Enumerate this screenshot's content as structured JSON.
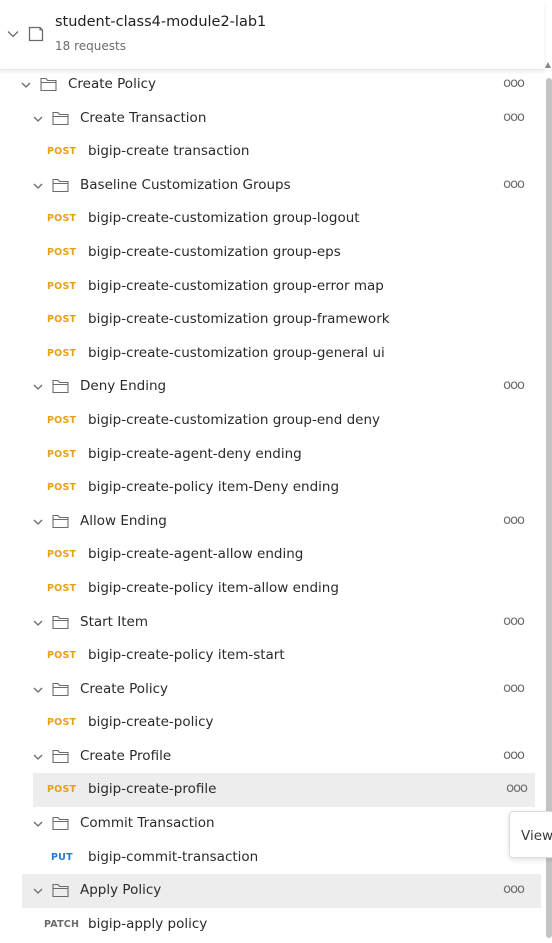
{
  "collection": {
    "name": "student-class4-module2-lab1",
    "request_count": "18 requests"
  },
  "tree": [
    {
      "kind": "folder",
      "depth": 0,
      "label": "Create Policy",
      "more": "ooo"
    },
    {
      "kind": "folder",
      "depth": 1,
      "label": "Create Transaction",
      "more": "ooo"
    },
    {
      "kind": "request",
      "method": "POST",
      "label": "bigip-create transaction"
    },
    {
      "kind": "folder",
      "depth": 1,
      "label": "Baseline Customization Groups",
      "more": "ooo"
    },
    {
      "kind": "request",
      "method": "POST",
      "label": "bigip-create-customization group-logout"
    },
    {
      "kind": "request",
      "method": "POST",
      "label": "bigip-create-customization group-eps"
    },
    {
      "kind": "request",
      "method": "POST",
      "label": "bigip-create-customization group-error map"
    },
    {
      "kind": "request",
      "method": "POST",
      "label": "bigip-create-customization group-framework"
    },
    {
      "kind": "request",
      "method": "POST",
      "label": "bigip-create-customization group-general ui"
    },
    {
      "kind": "folder",
      "depth": 1,
      "label": "Deny Ending",
      "more": "ooo"
    },
    {
      "kind": "request",
      "method": "POST",
      "label": "bigip-create-customization group-end deny"
    },
    {
      "kind": "request",
      "method": "POST",
      "label": "bigip-create-agent-deny ending"
    },
    {
      "kind": "request",
      "method": "POST",
      "label": "bigip-create-policy item-Deny ending"
    },
    {
      "kind": "folder",
      "depth": 1,
      "label": "Allow Ending",
      "more": "ooo"
    },
    {
      "kind": "request",
      "method": "POST",
      "label": "bigip-create-agent-allow ending"
    },
    {
      "kind": "request",
      "method": "POST",
      "label": "bigip-create-policy item-allow ending"
    },
    {
      "kind": "folder",
      "depth": 1,
      "label": "Start Item",
      "more": "ooo"
    },
    {
      "kind": "request",
      "method": "POST",
      "label": "bigip-create-policy item-start"
    },
    {
      "kind": "folder",
      "depth": 1,
      "label": "Create Policy",
      "more": "ooo"
    },
    {
      "kind": "request",
      "method": "POST",
      "label": "bigip-create-policy"
    },
    {
      "kind": "folder",
      "depth": 1,
      "label": "Create Profile",
      "more": "ooo"
    },
    {
      "kind": "request",
      "method": "POST",
      "label": "bigip-create-profile",
      "more": "ooo",
      "hovered": true
    },
    {
      "kind": "folder",
      "depth": 1,
      "label": "Commit Transaction"
    },
    {
      "kind": "request",
      "method": "PUT",
      "label": "bigip-commit-transaction"
    },
    {
      "kind": "folder",
      "depth": 1,
      "label": "Apply Policy",
      "more": "ooo",
      "selected": true
    },
    {
      "kind": "request",
      "method": "PATCH",
      "label": "bigip-apply policy"
    }
  ],
  "tooltip": {
    "text": "View"
  },
  "colors": {
    "post": "#e6a117",
    "put": "#2b78d5",
    "patch": "#6b6b6b",
    "highlight": "#ededed"
  }
}
